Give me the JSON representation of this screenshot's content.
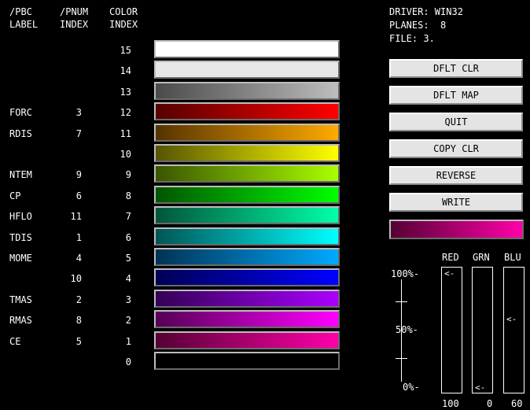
{
  "headers": {
    "pbc": "/PBC\nLABEL",
    "pnum": "/PNUM\nINDEX",
    "color": "COLOR\nINDEX"
  },
  "rows": [
    {
      "label": "",
      "pnum": "",
      "cidx": "15",
      "colors": [
        "#ffffff",
        "#ffffff"
      ]
    },
    {
      "label": "",
      "pnum": "",
      "cidx": "14",
      "colors": [
        "#e6e6e6",
        "#e6e6e6"
      ]
    },
    {
      "label": "",
      "pnum": "",
      "cidx": "13",
      "colors": [
        "#4a4a4a",
        "#bdbdbd"
      ]
    },
    {
      "label": "FORC",
      "pnum": "3",
      "cidx": "12",
      "colors": [
        "#550000",
        "#ff0000"
      ]
    },
    {
      "label": "RDIS",
      "pnum": "7",
      "cidx": "11",
      "colors": [
        "#553300",
        "#ffaa00"
      ]
    },
    {
      "label": "",
      "pnum": "",
      "cidx": "10",
      "colors": [
        "#555500",
        "#ffff00"
      ]
    },
    {
      "label": "NTEM",
      "pnum": "9",
      "cidx": "9",
      "colors": [
        "#3a5500",
        "#aaff00"
      ]
    },
    {
      "label": "CP",
      "pnum": "6",
      "cidx": "8",
      "colors": [
        "#005500",
        "#00ff00"
      ]
    },
    {
      "label": "HFLO",
      "pnum": "11",
      "cidx": "7",
      "colors": [
        "#00553a",
        "#00ffaa"
      ]
    },
    {
      "label": "TDIS",
      "pnum": "1",
      "cidx": "6",
      "colors": [
        "#005555",
        "#00ffff"
      ]
    },
    {
      "label": "MOME",
      "pnum": "4",
      "cidx": "5",
      "colors": [
        "#003355",
        "#00aaff"
      ]
    },
    {
      "label": "",
      "pnum": "10",
      "cidx": "4",
      "colors": [
        "#000055",
        "#0000ff"
      ]
    },
    {
      "label": "TMAS",
      "pnum": "2",
      "cidx": "3",
      "colors": [
        "#330055",
        "#aa00ff"
      ]
    },
    {
      "label": "RMAS",
      "pnum": "8",
      "cidx": "2",
      "colors": [
        "#550055",
        "#ff00ff"
      ]
    },
    {
      "label": "CE",
      "pnum": "5",
      "cidx": "1",
      "colors": [
        "#550033",
        "#ff00aa"
      ]
    },
    {
      "label": "",
      "pnum": "",
      "cidx": "0",
      "colors": [
        "#000000",
        "#000000"
      ]
    }
  ],
  "info": {
    "driver": "DRIVER: WIN32",
    "planes": "PLANES:  8",
    "file": "FILE: 3."
  },
  "buttons": [
    "DFLT CLR",
    "DFLT MAP",
    "QUIT",
    "COPY CLR",
    "REVERSE",
    "WRITE"
  ],
  "preview": {
    "colors": [
      "#550033",
      "#ff00aa"
    ]
  },
  "scale": {
    "top": "100%-",
    "mid": "50%-",
    "bottom": "0%-"
  },
  "sliders": [
    {
      "name": "red",
      "label": "RED",
      "value": "100",
      "level": 1.0,
      "arrow": "<-"
    },
    {
      "name": "grn",
      "label": "GRN",
      "value": "0",
      "level": 0.0,
      "arrow": "<-"
    },
    {
      "name": "blu",
      "label": "BLU",
      "value": "60",
      "level": 0.6,
      "arrow": "<-"
    }
  ]
}
